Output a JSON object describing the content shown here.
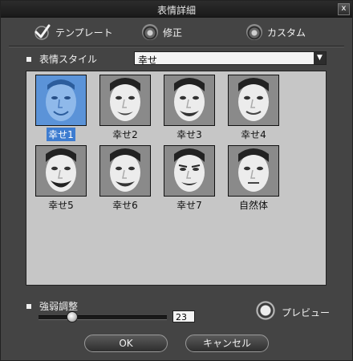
{
  "window": {
    "title": "表情詳細",
    "close_glyph": "x"
  },
  "modes": [
    {
      "label": "テンプレート",
      "icon": "checkmark-icon",
      "selected": true
    },
    {
      "label": "修正",
      "icon": "radio-icon",
      "selected": false
    },
    {
      "label": "カスタム",
      "icon": "radio-icon",
      "selected": false
    }
  ],
  "style": {
    "label": "表情スタイル",
    "value": "幸せ"
  },
  "thumbnails": [
    {
      "label": "幸せ1",
      "selected": true
    },
    {
      "label": "幸せ2",
      "selected": false
    },
    {
      "label": "幸せ3",
      "selected": false
    },
    {
      "label": "幸せ4",
      "selected": false
    },
    {
      "label": "幸せ5",
      "selected": false
    },
    {
      "label": "幸せ6",
      "selected": false
    },
    {
      "label": "幸せ7",
      "selected": false
    },
    {
      "label": "自然体",
      "selected": false
    }
  ],
  "intensity": {
    "label": "強弱調整",
    "value": "23"
  },
  "preview": {
    "label": "プレビュー",
    "icon": "eye-icon"
  },
  "buttons": {
    "ok": "OK",
    "cancel": "キャンセル"
  }
}
